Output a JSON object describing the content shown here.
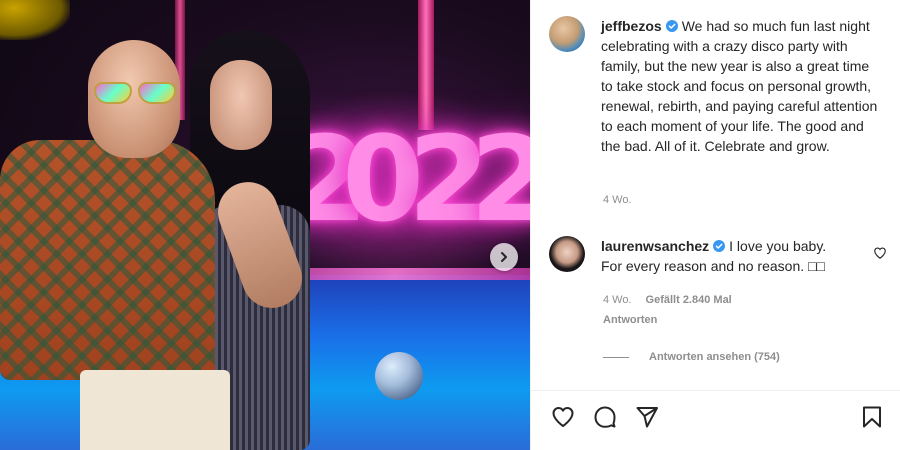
{
  "photo": {
    "year_digits": [
      "2",
      "0",
      "2",
      "2"
    ],
    "next_icon": "chevron-right-icon"
  },
  "caption": {
    "username": "jeffbezos",
    "verified_icon": "verified-badge-icon",
    "text": "We had so much fun last night celebrating with a crazy disco party with family, but the new year is also a great time to take stock and focus on personal growth, renewal, rebirth, and paying careful attention to each moment of your life. The good and the bad. All of it. Celebrate and grow.",
    "time": "4 Wo."
  },
  "reply": {
    "username": "laurenwsanchez",
    "verified_icon": "verified-badge-icon",
    "text": "I love you baby. For every reason and no reason. □□",
    "time": "4 Wo.",
    "likes": "Gefällt 2.840 Mal",
    "reply_label": "Antworten",
    "view_replies": "Antworten ansehen (754)",
    "like_icon": "heart-outline-icon"
  },
  "actions": {
    "like_icon": "heart-icon",
    "comment_icon": "comment-icon",
    "share_icon": "share-icon",
    "save_icon": "bookmark-icon"
  },
  "colors": {
    "verified": "#3897f0",
    "meta_text": "#8e8e8e",
    "neon_pink": "#ff8ce6"
  }
}
